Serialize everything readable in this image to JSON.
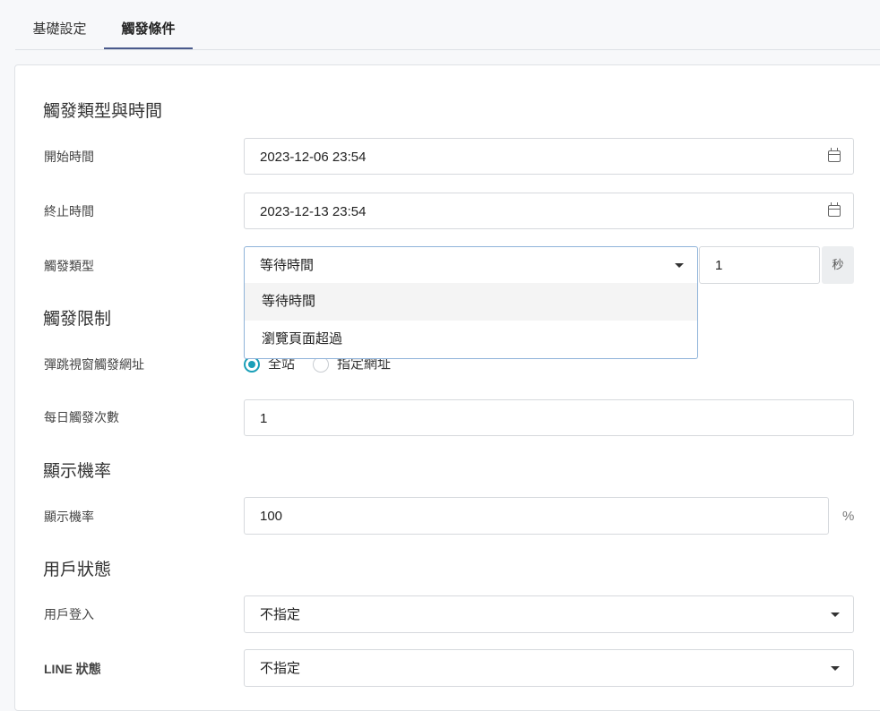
{
  "tabs": [
    {
      "label": "基礎設定",
      "active": false
    },
    {
      "label": "觸發條件",
      "active": true
    }
  ],
  "sections": {
    "trigger": "觸發類型與時間",
    "limit": "觸發限制",
    "probability": "顯示機率",
    "user_state": "用戶狀態"
  },
  "fields": {
    "start_time": {
      "label": "開始時間",
      "value": "2023-12-06 23:54"
    },
    "end_time": {
      "label": "終止時間",
      "value": "2023-12-13 23:54"
    },
    "trigger_type": {
      "label": "觸發類型",
      "selected": "等待時間",
      "amount": "1",
      "unit": "秒"
    },
    "popup_url": {
      "label": "彈跳視窗觸發網址",
      "options": [
        "全站",
        "指定網址"
      ],
      "selected": "全站"
    },
    "daily_count": {
      "label": "每日觸發次數",
      "value": "1"
    },
    "probability": {
      "label": "顯示機率",
      "value": "100",
      "unit": "%"
    },
    "user_login": {
      "label": "用戶登入",
      "value": "不指定"
    },
    "line_state": {
      "label": "LINE 狀態",
      "value": "不指定"
    }
  },
  "trigger_menu": {
    "options": [
      "等待時間",
      "瀏覽頁面超過"
    ],
    "highlighted": "等待時間"
  },
  "colors": {
    "accent": "#1a9fb8",
    "tab_underline": "#4a5a8c",
    "focus_border": "#8fb3d9"
  }
}
